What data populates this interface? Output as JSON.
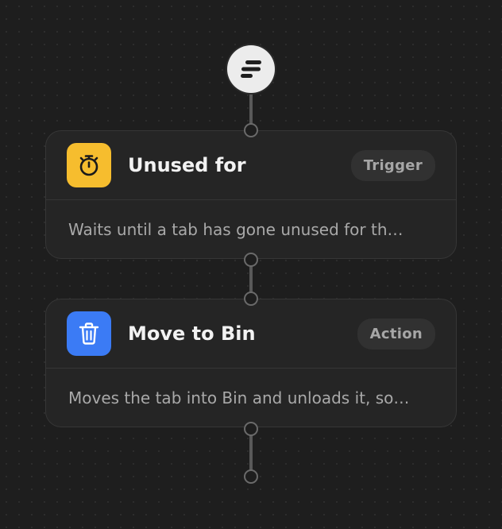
{
  "colors": {
    "background": "#1e1e1e",
    "card": "#252525",
    "trigger_icon_bg": "#f6bd2e",
    "action_icon_bg": "#3b7bf5",
    "connector": "#595959"
  },
  "start_node": {
    "icon": "flow-lines-icon"
  },
  "nodes": [
    {
      "title": "Unused for",
      "badge": "Trigger",
      "description": "Waits until a tab has gone unused for th…",
      "icon": "stopwatch-icon"
    },
    {
      "title": "Move to Bin",
      "badge": "Action",
      "description": "Moves the tab into Bin and unloads it, so…",
      "icon": "trash-icon"
    }
  ]
}
